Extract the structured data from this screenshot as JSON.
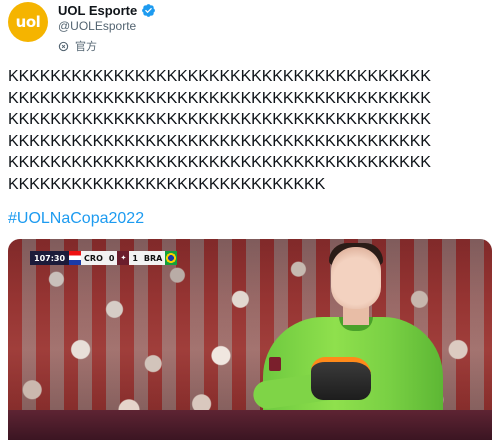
{
  "account": {
    "avatar_text": "uol",
    "display_name": "UOL Esporte",
    "handle": "@UOLEsporte",
    "meta_label": "官方"
  },
  "tweet": {
    "lines": [
      "KKKKKKKKKKKKKKKKKKKKKKKKKKKKKKKKKKKKKKKK",
      "KKKKKKKKKKKKKKKKKKKKKKKKKKKKKKKKKKKKKKKK",
      "KKKKKKKKKKKKKKKKKKKKKKKKKKKKKKKKKKKKKKKK",
      "KKKKKKKKKKKKKKKKKKKKKKKKKKKKKKKKKKKKKKKK",
      "KKKKKKKKKKKKKKKKKKKKKKKKKKKKKKKKKKKKKKKK",
      "KKKKKKKKKKKKKKKKKKKKKKKKKKKKKK"
    ],
    "hashtag": "#UOLNaCopa2022"
  },
  "scoreboard": {
    "time": "107:30",
    "home_team": "CRO",
    "home_score": "0",
    "mid": "✦",
    "away_score": "1",
    "away_team": "BRA"
  },
  "colors": {
    "brand": "#f5b400",
    "link": "#1d9bf0",
    "verified": "#1d9bf0"
  }
}
